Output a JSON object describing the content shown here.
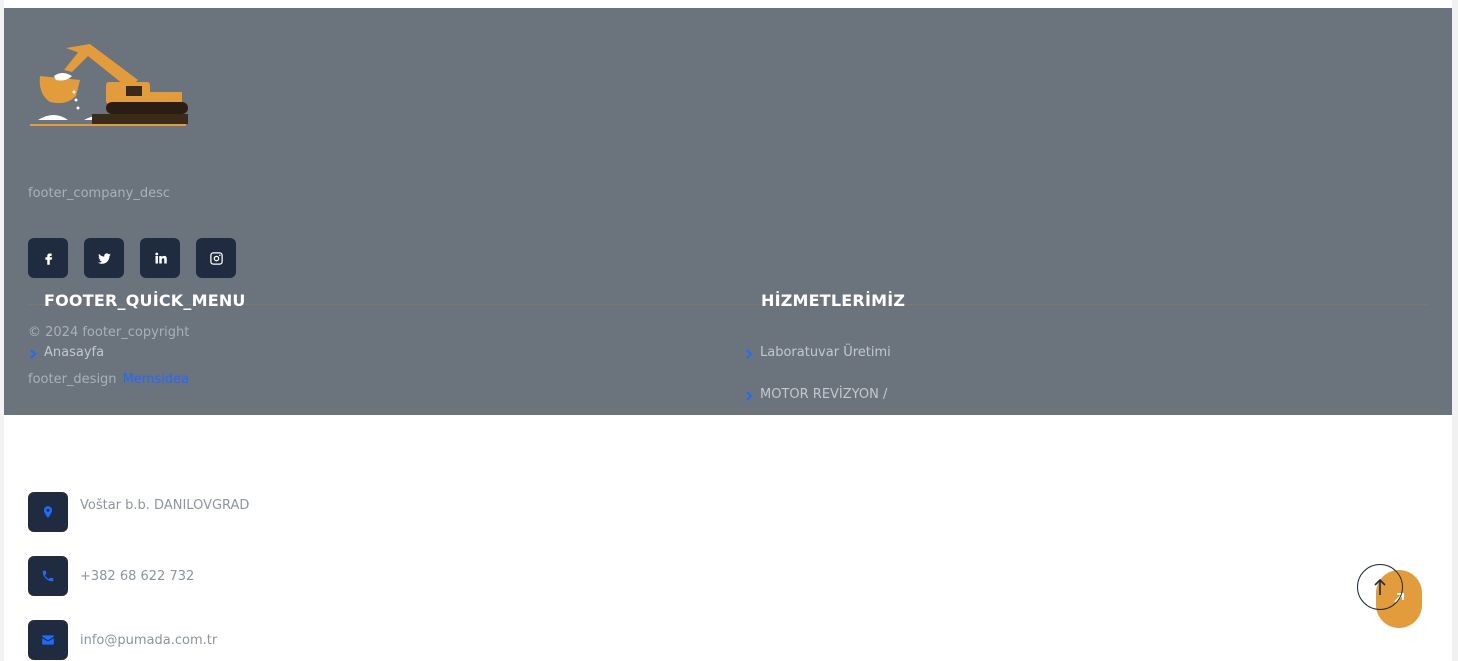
{
  "footer": {
    "company_desc": "footer_company_desc",
    "socials": [
      "facebook-icon",
      "twitter-icon",
      "linkedin-icon",
      "instagram-icon"
    ],
    "quick_menu_title": "FOOTER_QUİCK_MENU",
    "services_title": "HİZMETLERİMİZ",
    "copyright": "© 2024 footer_copyright",
    "quick_links": [
      "Anasayfa"
    ],
    "service_links": [
      "Laboratuvar Üretimi",
      "MOTOR REVİZYON /"
    ],
    "design_label": "footer_design",
    "design_link": "Memsidea"
  },
  "contact": {
    "address": "Voštar b.b. DANILOVGRAD",
    "phone": "+382 68 622 732",
    "email": "info@pumada.com.tr"
  },
  "colors": {
    "footer_bg": "#6b737d",
    "dark_box": "#1f2b3e",
    "accent_blue": "#1f6bff",
    "orange": "#e39c3c"
  }
}
